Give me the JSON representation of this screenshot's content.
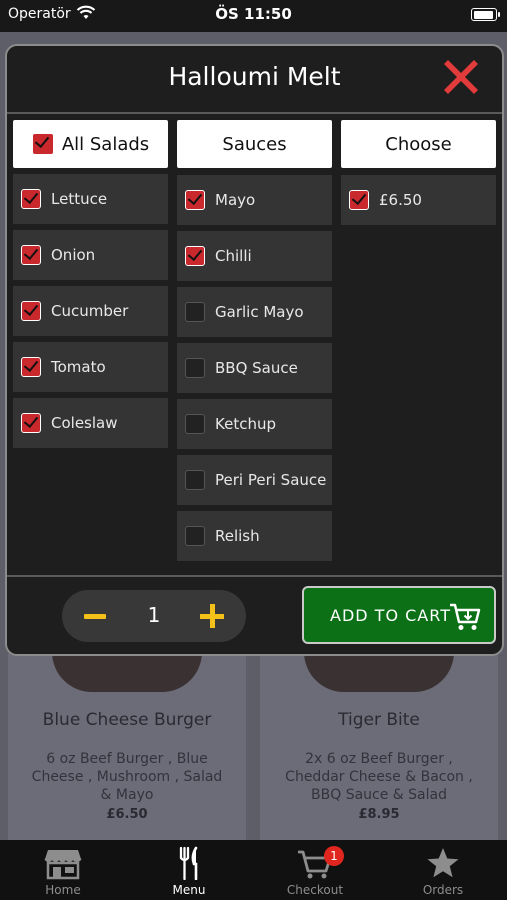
{
  "status_bar": {
    "carrier": "Operatör",
    "time": "ÖS 11:50"
  },
  "modal": {
    "title": "Halloumi Melt",
    "columns": [
      {
        "header": "All Salads",
        "header_checked": true,
        "options": [
          {
            "label": "Lettuce",
            "checked": true
          },
          {
            "label": "Onion",
            "checked": true
          },
          {
            "label": "Cucumber",
            "checked": true
          },
          {
            "label": "Tomato",
            "checked": true
          },
          {
            "label": "Coleslaw",
            "checked": true
          }
        ]
      },
      {
        "header": "Sauces",
        "options": [
          {
            "label": "Mayo",
            "checked": true
          },
          {
            "label": "Chilli",
            "checked": true
          },
          {
            "label": "Garlic Mayo",
            "checked": false
          },
          {
            "label": "BBQ Sauce",
            "checked": false
          },
          {
            "label": "Ketchup",
            "checked": false
          },
          {
            "label": "Peri Peri Sauce",
            "checked": false
          },
          {
            "label": "Relish",
            "checked": false
          }
        ]
      },
      {
        "header": "Choose",
        "options": [
          {
            "label": "£6.50",
            "checked": true
          }
        ]
      }
    ],
    "quantity": "1",
    "add_to_cart_label": "ADD TO CART"
  },
  "background_items": [
    {
      "title": "Blue Cheese Burger",
      "description": "6 oz Beef Burger , Blue Cheese , Mushroom , Salad & Mayo",
      "price": "£6.50"
    },
    {
      "title": "Tiger Bite",
      "description": "2x 6 oz Beef Burger , Cheddar Cheese & Bacon , BBQ Sauce & Salad",
      "price": "£8.95"
    }
  ],
  "tab_bar": {
    "items": [
      {
        "label": "Home",
        "icon": "store-icon"
      },
      {
        "label": "Menu",
        "icon": "cutlery-icon"
      },
      {
        "label": "Checkout",
        "icon": "cart-icon"
      },
      {
        "label": "Orders",
        "icon": "star-icon"
      }
    ],
    "active": "Menu",
    "checkout_badge": "1"
  },
  "colors": {
    "accent_yellow": "#f3c118",
    "close_red": "#e23b3b",
    "checkbox_red": "#c9282d",
    "cart_green": "#0b7016"
  }
}
